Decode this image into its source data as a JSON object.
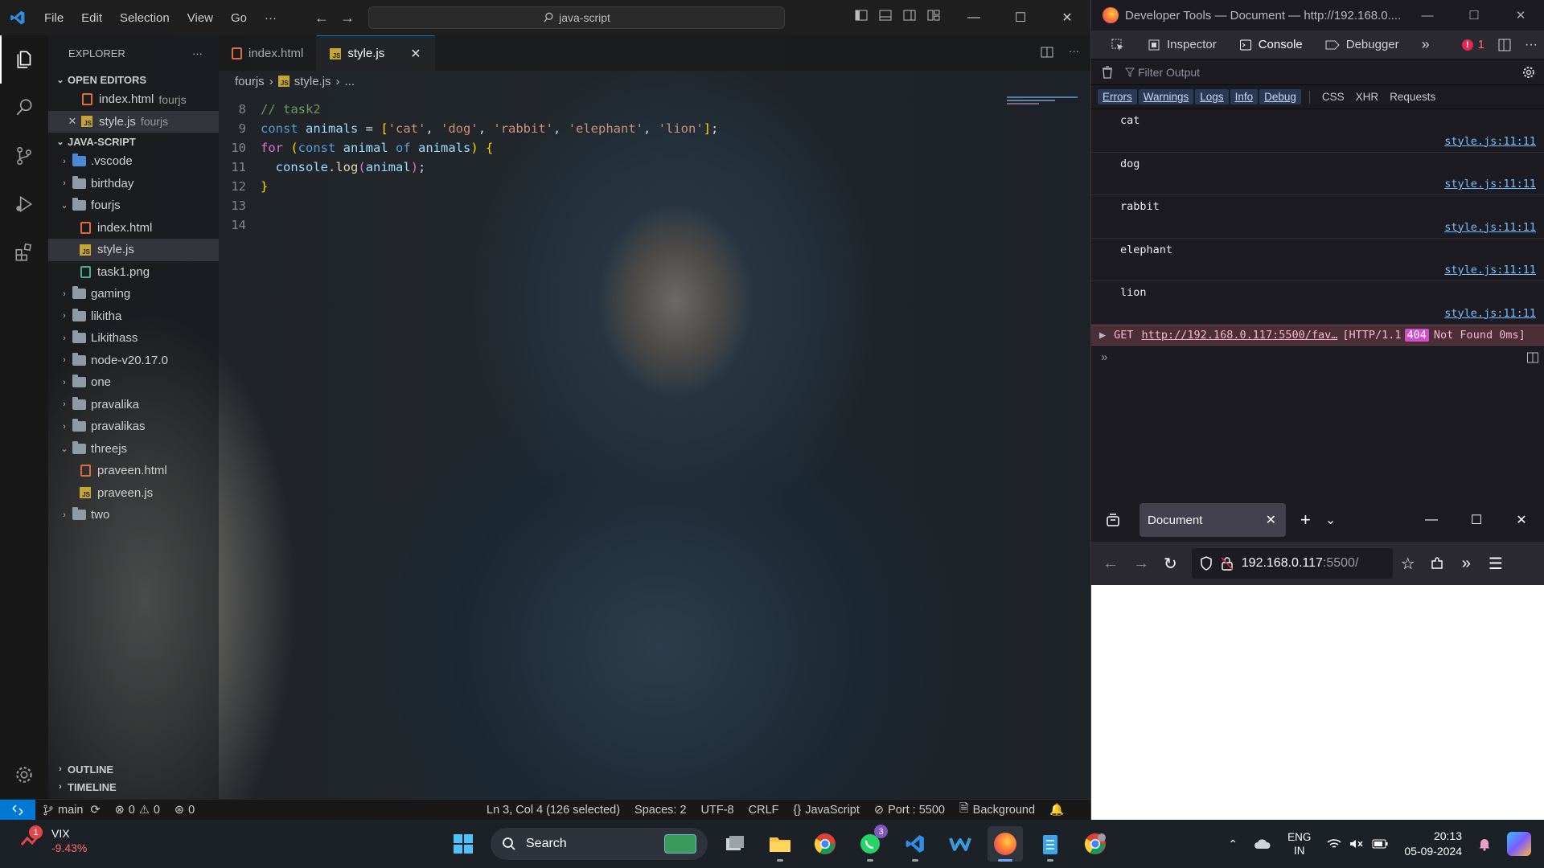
{
  "vscode": {
    "menu": [
      "File",
      "Edit",
      "Selection",
      "View",
      "Go",
      "···"
    ],
    "search_text": "java-script",
    "explorer_title": "EXPLORER",
    "open_editors_title": "OPEN EDITORS",
    "open_editors": [
      {
        "name": "index.html",
        "folder": "fourjs",
        "type": "html"
      },
      {
        "name": "style.js",
        "folder": "fourjs",
        "type": "js"
      }
    ],
    "workspace_title": "JAVA-SCRIPT",
    "tree": [
      {
        "name": ".vscode",
        "kind": "folder",
        "open": false,
        "indent": 0
      },
      {
        "name": "birthday",
        "kind": "folder",
        "open": false,
        "indent": 0
      },
      {
        "name": "fourjs",
        "kind": "folder",
        "open": true,
        "indent": 0
      },
      {
        "name": "index.html",
        "kind": "html",
        "indent": 1
      },
      {
        "name": "style.js",
        "kind": "js",
        "indent": 1
      },
      {
        "name": "task1.png",
        "kind": "img",
        "indent": 1
      },
      {
        "name": "gaming",
        "kind": "folder",
        "open": false,
        "indent": 0
      },
      {
        "name": "likitha",
        "kind": "folder",
        "open": false,
        "indent": 0
      },
      {
        "name": "Likithass",
        "kind": "folder",
        "open": false,
        "indent": 0
      },
      {
        "name": "node-v20.17.0",
        "kind": "folder",
        "open": false,
        "indent": 0
      },
      {
        "name": "one",
        "kind": "folder",
        "open": false,
        "indent": 0
      },
      {
        "name": "pravalika",
        "kind": "folder",
        "open": false,
        "indent": 0
      },
      {
        "name": "pravalikas",
        "kind": "folder",
        "open": false,
        "indent": 0
      },
      {
        "name": "threejs",
        "kind": "folder",
        "open": true,
        "indent": 0
      },
      {
        "name": "praveen.html",
        "kind": "html",
        "indent": 1
      },
      {
        "name": "praveen.js",
        "kind": "js",
        "indent": 1
      },
      {
        "name": "two",
        "kind": "folder",
        "open": false,
        "indent": 0
      }
    ],
    "outline_title": "OUTLINE",
    "timeline_title": "TIMELINE",
    "tabs": [
      {
        "label": "index.html",
        "type": "html",
        "active": false
      },
      {
        "label": "style.js",
        "type": "js",
        "active": true
      }
    ],
    "breadcrumb": [
      "fourjs",
      "style.js",
      "..."
    ],
    "code_lines": [
      {
        "num": "8",
        "tokens": [
          [
            "c",
            "// task2"
          ]
        ]
      },
      {
        "num": "9",
        "tokens": [
          [
            "k",
            "const "
          ],
          [
            "v",
            "animals"
          ],
          [
            "p",
            " = "
          ],
          [
            "b",
            "["
          ],
          [
            "s",
            "'cat'"
          ],
          [
            "p",
            ", "
          ],
          [
            "s",
            "'dog'"
          ],
          [
            "p",
            ", "
          ],
          [
            "s",
            "'rabbit'"
          ],
          [
            "p",
            ", "
          ],
          [
            "s",
            "'elephant'"
          ],
          [
            "p",
            ", "
          ],
          [
            "s",
            "'lion'"
          ],
          [
            "b",
            "]"
          ],
          [
            "p",
            ";"
          ]
        ]
      },
      {
        "num": "10",
        "tokens": [
          [
            "b2",
            "for "
          ],
          [
            "b",
            "("
          ],
          [
            "k",
            "const "
          ],
          [
            "v",
            "animal "
          ],
          [
            "k",
            "of "
          ],
          [
            "v",
            "animals"
          ],
          [
            "b",
            ") "
          ],
          [
            "b",
            "{"
          ]
        ]
      },
      {
        "num": "11",
        "tokens": [
          [
            "p",
            "  "
          ],
          [
            "v",
            "console"
          ],
          [
            "p",
            "."
          ],
          [
            "f",
            "log"
          ],
          [
            "b2",
            "("
          ],
          [
            "v",
            "animal"
          ],
          [
            "b2",
            ")"
          ],
          [
            "p",
            ";"
          ]
        ]
      },
      {
        "num": "12",
        "tokens": [
          [
            "b",
            "}"
          ]
        ]
      },
      {
        "num": "13",
        "tokens": []
      },
      {
        "num": "14",
        "tokens": []
      }
    ],
    "status": {
      "branch": "main",
      "errors": "0",
      "warnings": "0",
      "ports": "0",
      "position": "Ln 3, Col 4 (126 selected)",
      "spaces": "Spaces: 2",
      "encoding": "UTF-8",
      "eol": "CRLF",
      "language": "JavaScript",
      "port": "Port : 5500",
      "background": "Background"
    }
  },
  "devtools": {
    "title": "Developer Tools — Document — http://192.168.0....",
    "tools": [
      "Inspector",
      "Console",
      "Debugger"
    ],
    "error_count": "1",
    "filter_placeholder": "Filter Output",
    "levels": [
      "Errors",
      "Warnings",
      "Logs",
      "Info",
      "Debug"
    ],
    "types": [
      "CSS",
      "XHR",
      "Requests"
    ],
    "messages": [
      {
        "text": "cat",
        "source": "style.js:11:11"
      },
      {
        "text": "dog",
        "source": "style.js:11:11"
      },
      {
        "text": "rabbit",
        "source": "style.js:11:11"
      },
      {
        "text": "elephant",
        "source": "style.js:11:11"
      },
      {
        "text": "lion",
        "source": "style.js:11:11"
      }
    ],
    "error": {
      "method": "GET",
      "url": "http://192.168.0.117:5500/fav…",
      "proto": "[HTTP/1.1",
      "code": "404",
      "status": "Not Found 0ms]"
    }
  },
  "firefox": {
    "tab_title": "Document",
    "url_host": "192.168.0.117",
    "url_port": ":5500/"
  },
  "taskbar": {
    "stock_name": "VIX",
    "stock_change": "-9.43%",
    "stock_badge": "1",
    "search_label": "Search",
    "whatsapp_badge": "3",
    "lang_top": "ENG",
    "lang_bottom": "IN",
    "time": "20:13",
    "date": "05-09-2024"
  },
  "colors": {
    "accent": "#0078d4",
    "console_link": "#75bfff",
    "error_bg": "#4b2f36",
    "status_404": "#d24dcd"
  }
}
